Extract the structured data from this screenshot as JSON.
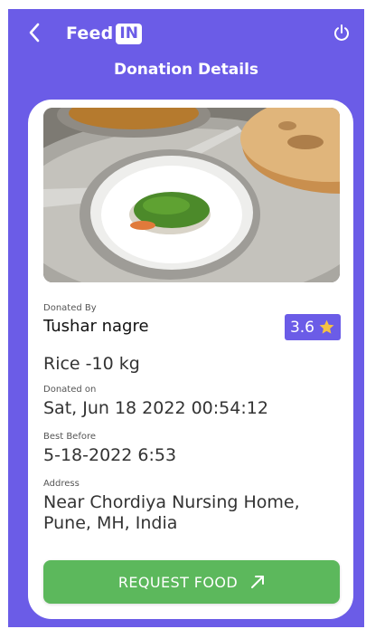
{
  "header": {
    "brand_text": "Feed",
    "brand_badge": "IN",
    "title": "Donation Details"
  },
  "donation": {
    "donated_by_label": "Donated By",
    "donor_name": "Tushar nagre",
    "rating": "3.6",
    "item": "Rice -10 kg",
    "donated_on_label": "Donated on",
    "donated_on": "Sat, Jun 18 2022 00:54:12",
    "best_before_label": "Best Before",
    "best_before": "5-18-2022 6:53",
    "address_label": "Address",
    "address_line1": "Near Chordiya Nursing Home,",
    "address_line2": "Pune, MH, India"
  },
  "actions": {
    "request_label": "REQUEST FOOD"
  },
  "icons": {
    "back": "back-arrow-icon",
    "power": "power-icon",
    "star": "star-icon",
    "arrow": "arrow-up-right-icon"
  },
  "colors": {
    "primary": "#6b5ce7",
    "button_green": "#5cb85c",
    "star": "#f5c242"
  }
}
